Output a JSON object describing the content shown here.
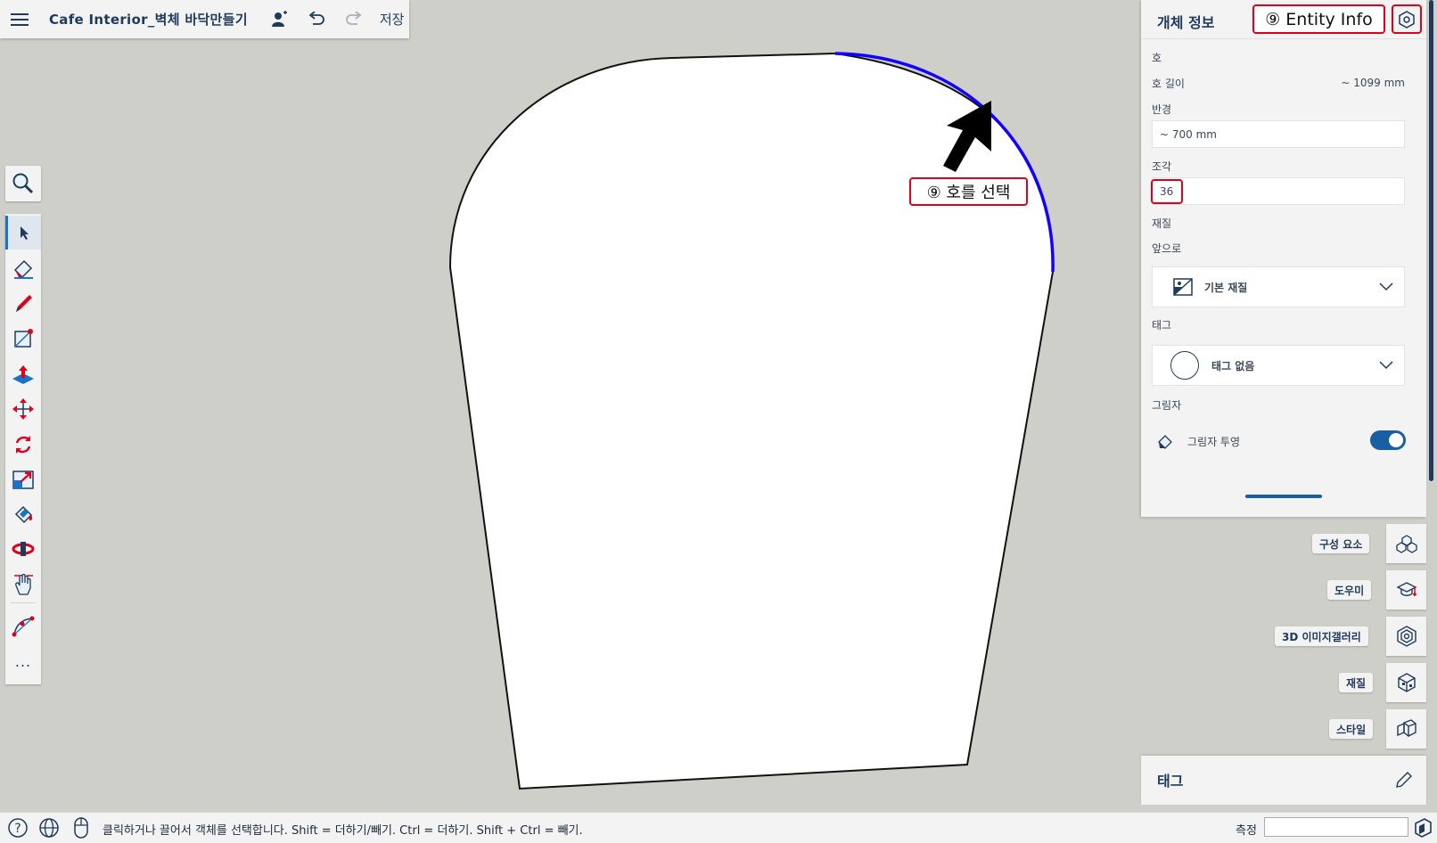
{
  "app": {
    "title": "Cafe Interior_벽체 바닥만들기",
    "save_label": "저장"
  },
  "toolbar": {
    "tools": [
      "search-icon",
      "select-icon",
      "eraser-icon",
      "pencil-icon",
      "rectangle-icon",
      "push-pull-icon",
      "move-icon",
      "rotate-icon",
      "scale-icon",
      "paint-bucket-icon",
      "orbit-icon",
      "pan-icon",
      "arc-icon",
      "more-icon"
    ],
    "more_label": "..."
  },
  "entity_info": {
    "title": "개체 정보",
    "type_label": "호",
    "arc_length_label": "호 길이",
    "arc_length_value": "~ 1099 mm",
    "radius_label": "반경",
    "radius_value": "~ 700 mm",
    "segments_label": "조각",
    "segments_value": "36",
    "material_label": "재질",
    "front_label": "앞으로",
    "material_value": "기본 재질",
    "tag_label": "태그",
    "tag_value": "태그 없음",
    "shadow_label": "그림자",
    "cast_shadow_label": "그림자 투영",
    "cast_shadow_on": true
  },
  "side_tray": {
    "items": [
      {
        "label": "구성 요소",
        "icon": "components-icon"
      },
      {
        "label": "도우미",
        "icon": "instructor-icon"
      },
      {
        "label": "3D 이미지갤러리",
        "icon": "3d-warehouse-icon"
      },
      {
        "label": "재질",
        "icon": "materials-icon"
      },
      {
        "label": "스타일",
        "icon": "styles-icon"
      }
    ],
    "tags_panel_title": "태그"
  },
  "annotations": {
    "entity_info_callout": "⑨ Entity Info",
    "select_arc_callout": "⑨ 호를 선택"
  },
  "status": {
    "hint": "클릭하거나 끌어서 객체를 선택합니다. Shift = 더하기/빼기. Ctrl = 더하기. Shift + Ctrl = 빼기.",
    "measure_label": "측정",
    "measure_value": ""
  },
  "colors": {
    "accent": "#1a73c8",
    "selected_arc": "#1400ff",
    "callout_border": "#e0001b",
    "toggle_on": "#1a5ea3"
  }
}
